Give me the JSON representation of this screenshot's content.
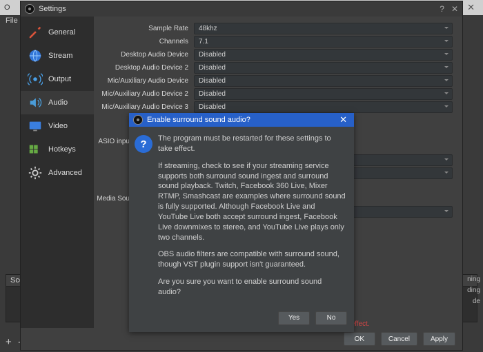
{
  "bg": {
    "title": "O",
    "menu_file": "File",
    "scene_panel": "Scene",
    "plus": "+",
    "minus": "–",
    "rlines": [
      "ning",
      "ding",
      "de"
    ]
  },
  "settings": {
    "title": "Settings",
    "help": "?",
    "close": "✕",
    "nav": {
      "general": "General",
      "stream": "Stream",
      "output": "Output",
      "audio": "Audio",
      "video": "Video",
      "hotkeys": "Hotkeys",
      "advanced": "Advanced"
    },
    "labels": {
      "sample_rate": "Sample Rate",
      "channels": "Channels",
      "dad": "Desktop Audio Device",
      "dad2": "Desktop Audio Device 2",
      "mad": "Mic/Auxiliary Audio Device",
      "mad2": "Mic/Auxiliary Audio Device 2",
      "mad3": "Mic/Auxiliary Audio Device 3",
      "audio_short": "Audio",
      "asio": "ASIO inpu",
      "media": "Media Sou"
    },
    "values": {
      "sample_rate": "48khz",
      "channels": "7.1",
      "dad": "Disabled",
      "dad2": "Disabled",
      "mad": "Disabled",
      "mad2": "Disabled",
      "mad3": "Disabled"
    },
    "warn": "The program must be restarted for these settings to take effect.",
    "buttons": {
      "ok": "OK",
      "cancel": "Cancel",
      "apply": "Apply"
    }
  },
  "dialog": {
    "title": "Enable surround sound audio?",
    "p1": "The program must be restarted for these settings to take effect.",
    "p2": "If streaming, check to see if your streaming service supports both surround sound ingest and surround sound playback. Twitch, Facebook 360 Live, Mixer RTMP, Smashcast are examples where surround sound is fully supported.  Although Facebook Live and YouTube Live both accept surround ingest, Facebook Live downmixes to stereo, and YouTube Live plays only two channels.",
    "p3": "OBS audio filters are compatible with surround sound, though VST plugin support isn't guaranteed.",
    "p4": "Are you sure you want to enable surround sound audio?",
    "yes": "Yes",
    "no": "No",
    "close": "✕"
  }
}
